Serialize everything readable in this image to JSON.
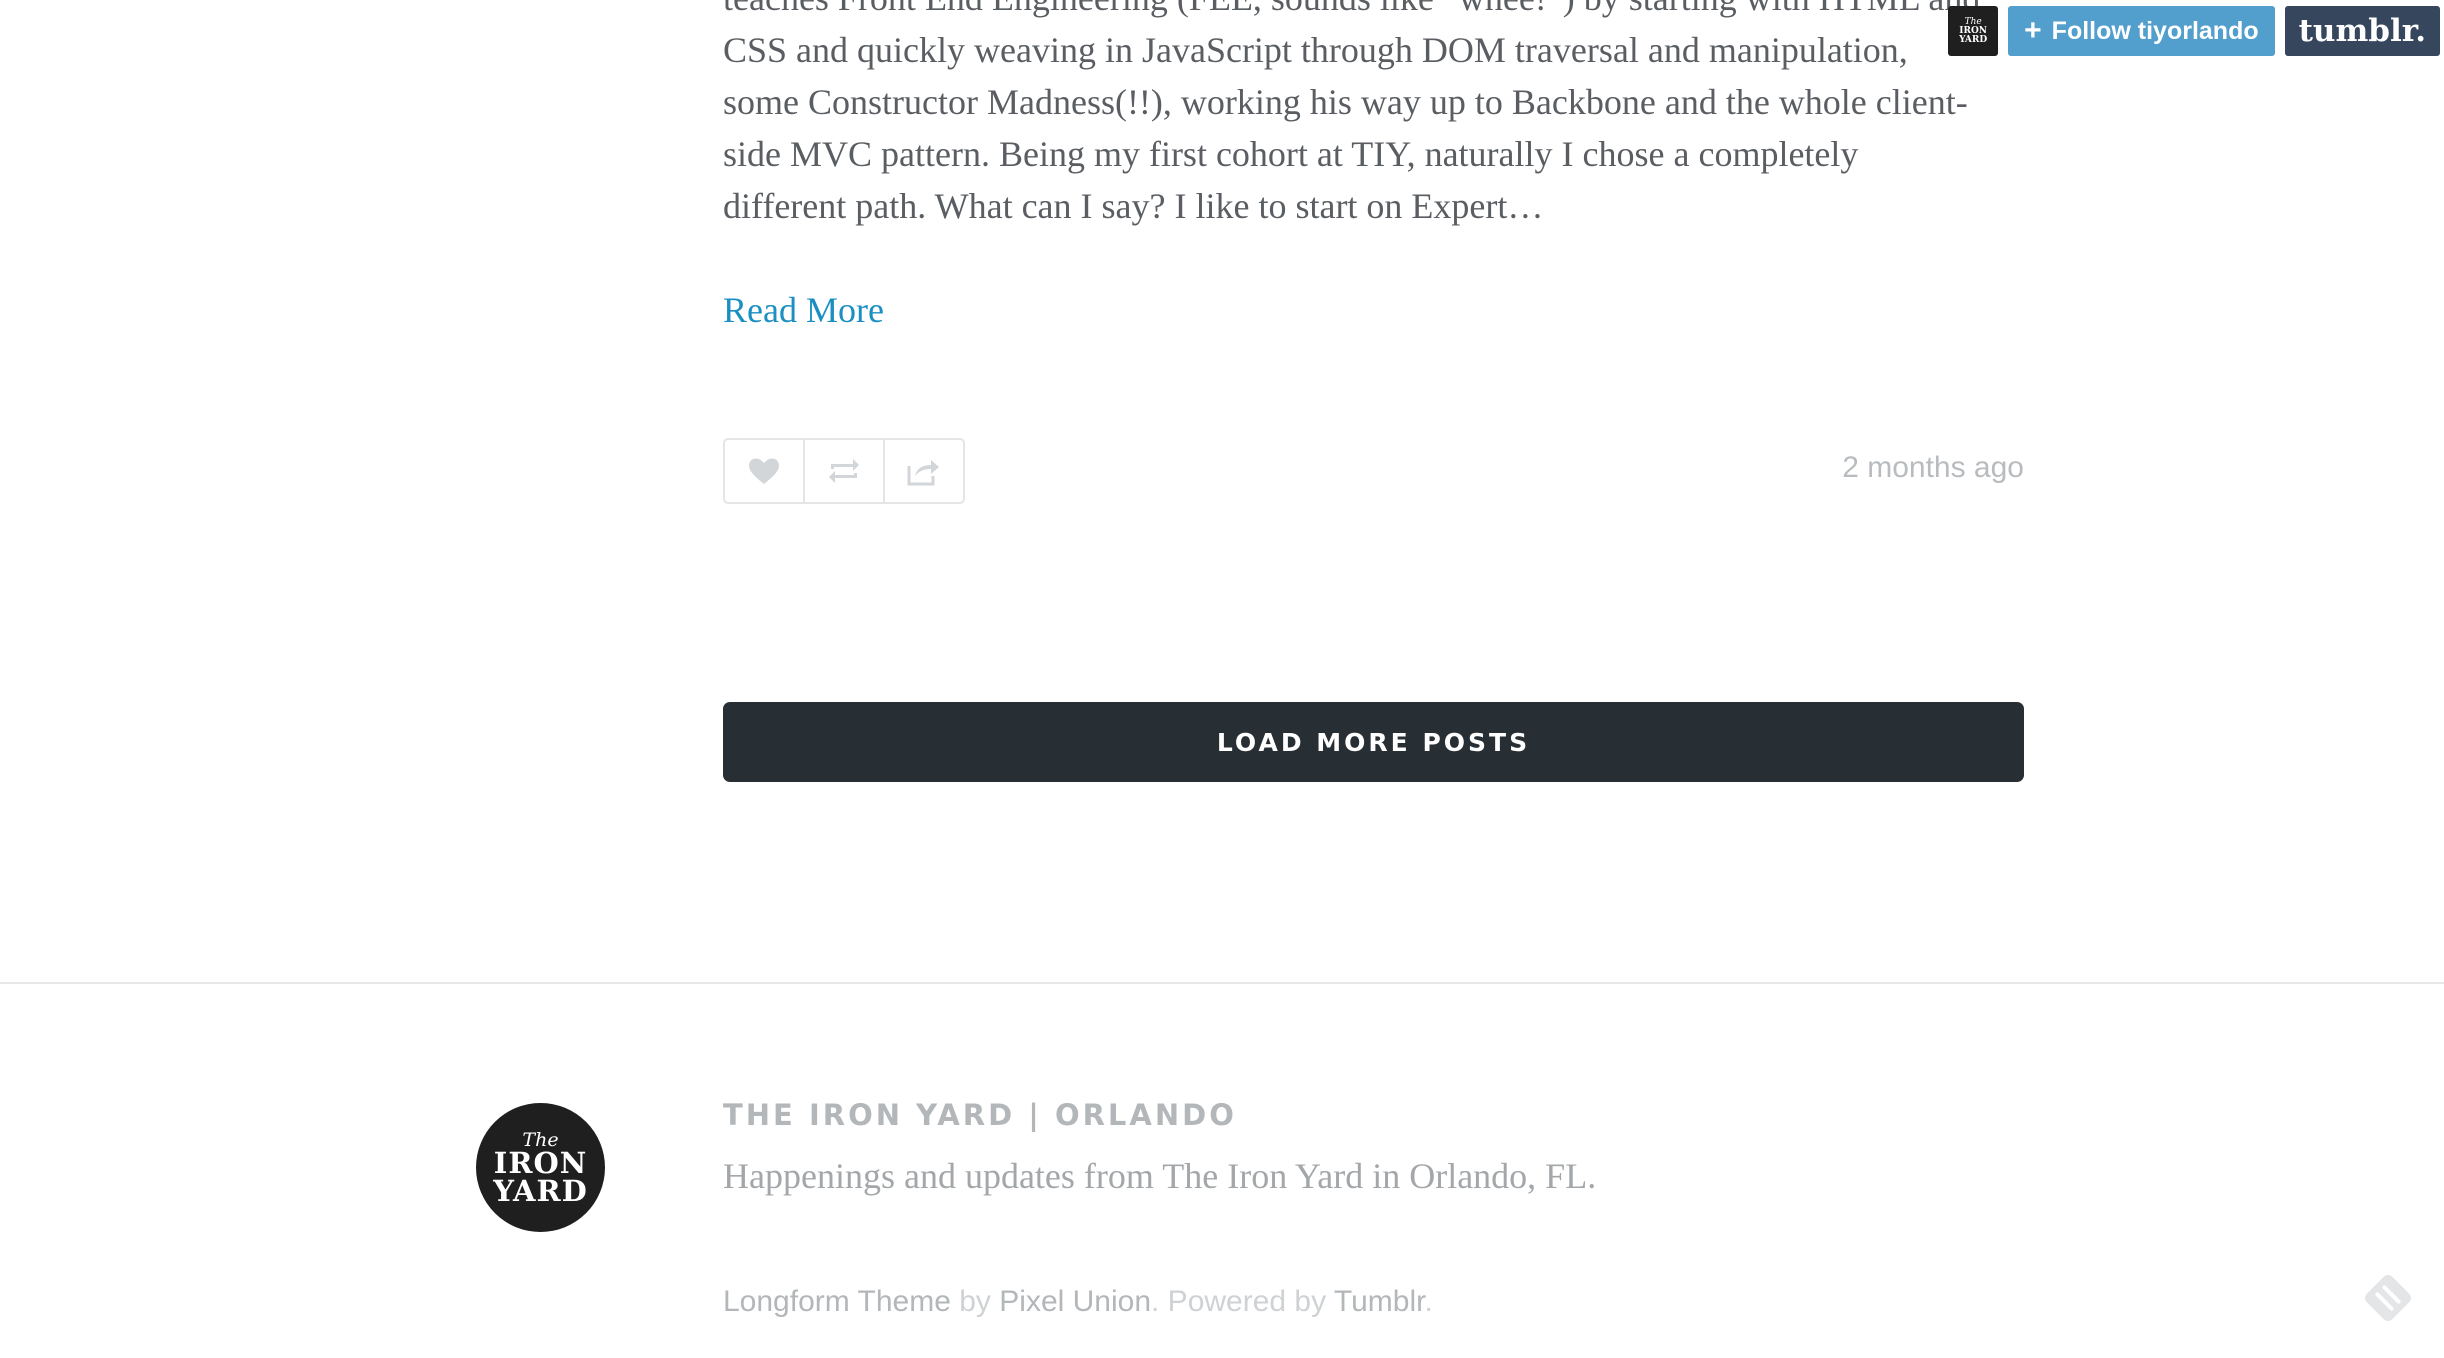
{
  "post": {
    "excerpt_lines": [
      "teaches Front End Engineering (FEE, sounds like “whee!”) by starting with HTML and",
      "CSS and quickly weaving in JavaScript through DOM traversal and manipulation,",
      "some Constructor Madness(!!), working his way up to Backbone and the whole client-",
      "side MVC pattern. Being my first cohort at TIY, naturally I chose a completely",
      "different path. What can I say? I like to start on Expert…"
    ],
    "read_more": "Read More",
    "date": "2 months ago",
    "actions": [
      "like-icon",
      "reblog-icon",
      "share-icon"
    ]
  },
  "load_more": {
    "label": "LOAD MORE POSTS"
  },
  "footer": {
    "logo": {
      "the": "The",
      "line1": "IRON",
      "line2": "YARD"
    },
    "title": "THE IRON YARD | ORLANDO",
    "description": "Happenings and updates from The Iron Yard in Orlando, FL.",
    "credits": {
      "theme": "Longform Theme",
      "by": " by ",
      "author": "Pixel Union",
      "powered": ". Powered by ",
      "platform": "Tumblr",
      "end": "."
    },
    "feed_icon": "rss-feed-icon"
  },
  "tumblr_controls": {
    "avatar": {
      "the": "The",
      "line1": "IRON",
      "line2": "YARD"
    },
    "follow_label": "Follow tiyorlando",
    "follow_plus": "+",
    "logo_text": "tumblr."
  },
  "colors": {
    "link": "#1b8fc2",
    "load_more_bg": "#272e34",
    "follow_bg": "#529ecc",
    "tumblr_bg": "#36465d"
  }
}
